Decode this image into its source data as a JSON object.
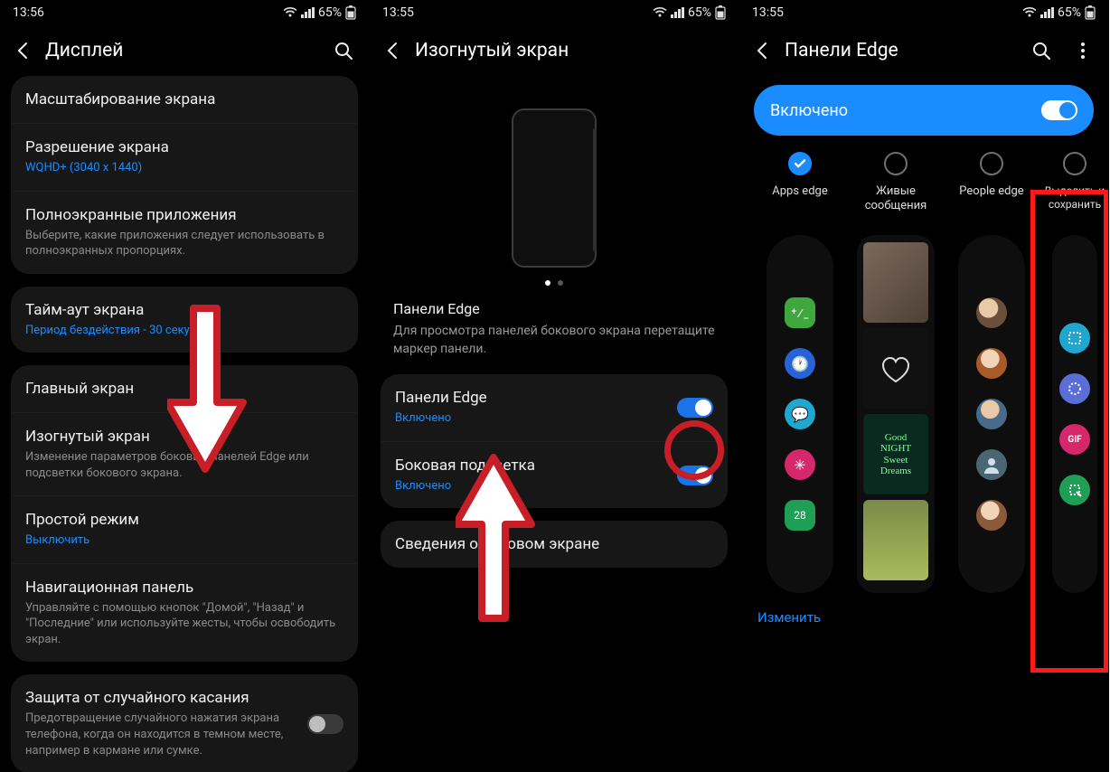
{
  "status": {
    "time_a": "13:56",
    "time_b": "13:55",
    "time_c": "13:55",
    "battery": "65%"
  },
  "screen1": {
    "title": "Дисплей",
    "items": {
      "scaling": {
        "title": "Масштабирование экрана"
      },
      "resolution": {
        "title": "Разрешение экрана",
        "sub": "WQHD+ (3040 x 1440)"
      },
      "fullscreen": {
        "title": "Полноэкранные приложения",
        "sub": "Выберите, какие приложения следует использовать в полноэкранных пропорциях."
      },
      "timeout": {
        "title": "Тайм-аут экрана",
        "sub": "Период бездействия - 30 секунд"
      },
      "home": {
        "title": "Главный экран"
      },
      "edge": {
        "title": "Изогнутый экран",
        "sub": "Изменение параметров боковых панелей Edge или подсветки бокового экрана."
      },
      "easy": {
        "title": "Простой режим",
        "sub": "Выключить"
      },
      "nav": {
        "title": "Навигационная панель",
        "sub": "Управляйте с помощью кнопок \"Домой\", \"Назад\" и \"Последние\" или используйте жесты, чтобы освободить экран."
      },
      "accidental": {
        "title": "Защита от случайного касания",
        "sub": "Предотвращение случайного нажатия экрана телефона, когда он находится в темном месте, например в кармане или сумке."
      }
    }
  },
  "screen2": {
    "title": "Изогнутый экран",
    "desc_title": "Панели Edge",
    "desc_body": "Для просмотра панелей бокового экрана перетащите маркер панели.",
    "items": {
      "panels": {
        "title": "Панели Edge",
        "sub": "Включено"
      },
      "light": {
        "title": "Боковая подсветка",
        "sub": "Включено"
      },
      "about": {
        "title": "Сведения о боковом экране"
      }
    }
  },
  "screen3": {
    "title": "Панели Edge",
    "enabled_label": "Включено",
    "edit": "Изменить",
    "cols": {
      "apps": "Apps edge",
      "live": "Живые сообщения",
      "people": "People edge",
      "select": "Выделить и сохранить"
    }
  }
}
